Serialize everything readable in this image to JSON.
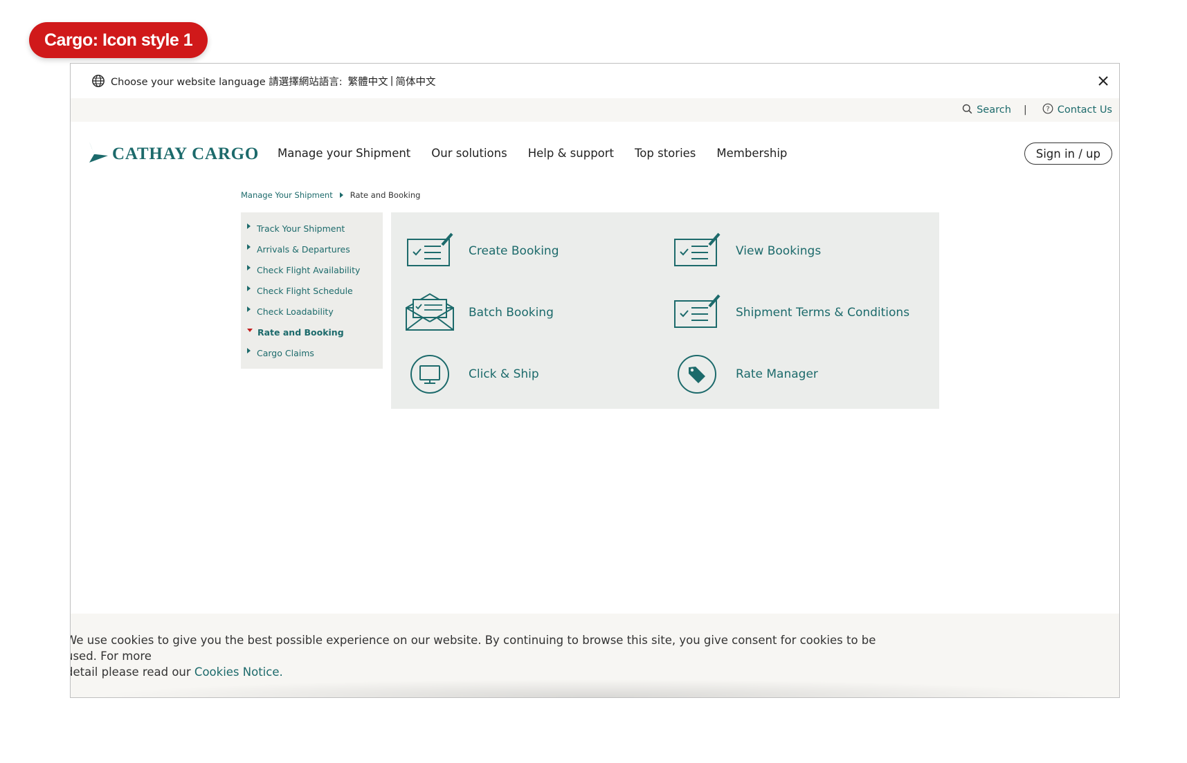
{
  "badge": {
    "label": "Cargo: Icon style 1"
  },
  "language_bar": {
    "text": "Choose your website language 請選擇網站語言:",
    "option_traditional": "繁體中文",
    "separator": "|",
    "option_simplified": "简体中文"
  },
  "utility": {
    "search": "Search",
    "separator": "|",
    "contact": "Contact Us"
  },
  "logo": {
    "text": "CATHAY CARGO"
  },
  "nav": {
    "items": [
      "Manage your Shipment",
      "Our solutions",
      "Help & support",
      "Top stories",
      "Membership"
    ],
    "signin": "Sign in / up"
  },
  "breadcrumb": {
    "parent": "Manage Your Shipment",
    "current": "Rate and Booking"
  },
  "sidebar": {
    "items": [
      "Track Your Shipment",
      "Arrivals & Departures",
      "Check Flight Availability",
      "Check Flight Schedule",
      "Check Loadability",
      "Rate and Booking",
      "Cargo Claims"
    ]
  },
  "cards": {
    "create_booking": "Create Booking",
    "view_bookings": "View Bookings",
    "batch_booking": "Batch Booking",
    "shipment_terms": "Shipment Terms & Conditions",
    "click_ship": "Click & Ship",
    "rate_manager": "Rate Manager"
  },
  "cookie": {
    "line1": "We use cookies to give you the best possible experience on our website. By continuing to browse this site, you give consent for cookies to be used. For more",
    "line2": "detail please read our ",
    "link": "Cookies Notice."
  },
  "colors": {
    "brand": "#1c6a6b",
    "badge": "#d0191a",
    "active_marker": "#c41f1f"
  }
}
